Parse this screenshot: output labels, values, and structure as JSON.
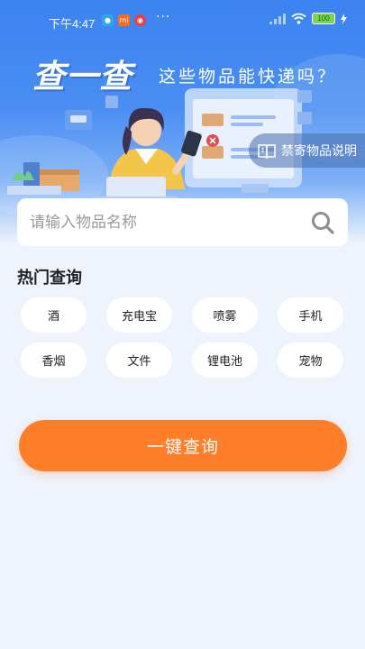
{
  "status_bar": {
    "time": "下午4:47",
    "app_icons": [
      "message-app-icon",
      "mi-app-icon",
      "weibo-app-icon"
    ],
    "more": "···",
    "battery": "100"
  },
  "hero": {
    "title": "查一查",
    "subtitle": "这些物品能快递吗？"
  },
  "notice_tag": {
    "label": "禁寄物品说明"
  },
  "search": {
    "placeholder": "请输入物品名称",
    "value": ""
  },
  "hot": {
    "title": "热门查询",
    "items": [
      {
        "label": "酒"
      },
      {
        "label": "充电宝"
      },
      {
        "label": "喷雾"
      },
      {
        "label": "手机"
      },
      {
        "label": "香烟"
      },
      {
        "label": "文件"
      },
      {
        "label": "锂电池"
      },
      {
        "label": "宠物"
      }
    ]
  },
  "cta": {
    "label": "一键查询"
  },
  "colors": {
    "primary_blue": "#3c83f0",
    "accent_orange": "#ff7e2a",
    "page_bg": "#eef3fc"
  }
}
